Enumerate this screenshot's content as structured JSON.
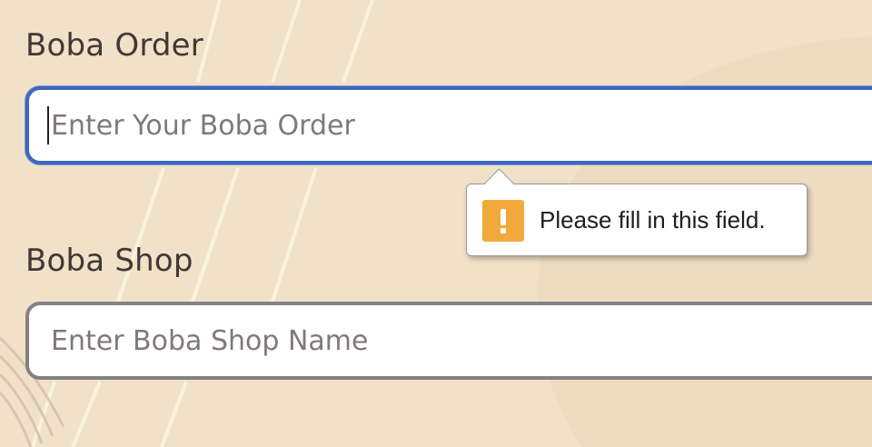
{
  "form": {
    "order_label": "Boba Order",
    "order_placeholder": "Enter Your Boba Order",
    "order_value": "",
    "shop_label": "Boba Shop",
    "shop_placeholder": "Enter Boba Shop Name",
    "shop_value": ""
  },
  "validation_tooltip": {
    "message": "Please fill in this field.",
    "icon": "warning-icon"
  },
  "colors": {
    "background": "#f0e1c8",
    "label_text": "#433735",
    "focused_border": "#3f67be",
    "default_border": "#858086",
    "warning": "#f2a93b"
  }
}
